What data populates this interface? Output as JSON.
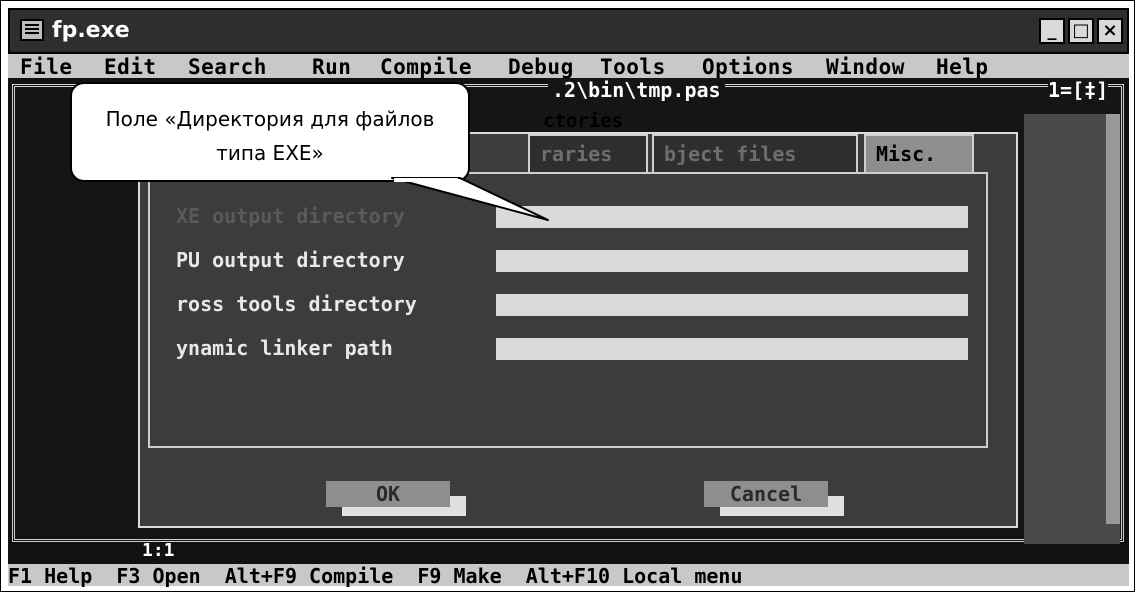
{
  "window": {
    "title": "fp.exe",
    "minimize_label": "_",
    "maximize_label": "□",
    "close_label": "×"
  },
  "menu": [
    "File",
    "Edit",
    "Search",
    "Run",
    "Compile",
    "Debug",
    "Tools",
    "Options",
    "Window",
    "Help"
  ],
  "editor": {
    "title_fragment": ".2\\bin\\tmp.pas",
    "window_number": "1=[‡]"
  },
  "dialog": {
    "title_fragment": "ctories",
    "tabs": [
      {
        "label": "raries",
        "active": false
      },
      {
        "label": "bject files",
        "active": false
      },
      {
        "label": "Misc.",
        "active": true
      }
    ],
    "fields": [
      {
        "label": "XE output directory",
        "value": ""
      },
      {
        "label": "PU output directory",
        "value": ""
      },
      {
        "label": "ross tools directory",
        "value": ""
      },
      {
        "label": "ynamic linker path",
        "value": ""
      }
    ],
    "ok_label": "OK",
    "cancel_label": "Cancel"
  },
  "status": {
    "position": "1:1"
  },
  "hotkeys": "F1 Help  F3 Open  Alt+F9 Compile  F9 Make  Alt+F10 Local menu",
  "callout": {
    "line1": "Поле «Директория для файлов",
    "line2": "типа EXE»"
  },
  "colors": {
    "screen_bg": "#111111",
    "menu_bg": "#c8c8c8",
    "dialog_bg": "#3c3c3c"
  }
}
